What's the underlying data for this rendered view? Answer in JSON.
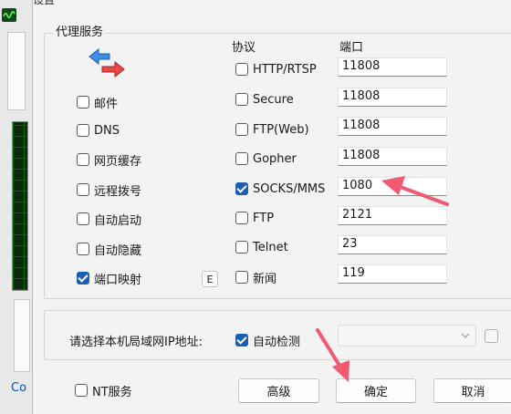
{
  "background": {
    "link_text": "Co"
  },
  "dialog": {
    "title": "设置"
  },
  "proxy_group": {
    "title": "代理服务",
    "headers": {
      "protocol": "协议",
      "port": "端口"
    },
    "services": [
      {
        "label": "邮件",
        "checked": false
      },
      {
        "label": "DNS",
        "checked": false
      },
      {
        "label": "网页缓存",
        "checked": false
      },
      {
        "label": "远程拨号",
        "checked": false
      },
      {
        "label": "自动启动",
        "checked": false
      },
      {
        "label": "自动隐藏",
        "checked": false
      },
      {
        "label": "端口映射",
        "checked": true
      }
    ],
    "port_map_button": "E",
    "protocols": [
      {
        "label": "HTTP/RTSP",
        "checked": false,
        "port": "11808"
      },
      {
        "label": "Secure",
        "checked": false,
        "port": "11808"
      },
      {
        "label": "FTP(Web)",
        "checked": false,
        "port": "11808"
      },
      {
        "label": "Gopher",
        "checked": false,
        "port": "11808"
      },
      {
        "label": "SOCKS/MMS",
        "checked": true,
        "port": "1080"
      },
      {
        "label": "FTP",
        "checked": false,
        "port": "2121"
      },
      {
        "label": "Telnet",
        "checked": false,
        "port": "23"
      },
      {
        "label": "新闻",
        "checked": false,
        "port": "119"
      }
    ]
  },
  "lan_group": {
    "label": "请选择本机局域网IP地址:",
    "auto_detect": {
      "label": "自动检测",
      "checked": true
    },
    "ip_value": ""
  },
  "footer": {
    "nt_service": {
      "label": "NT服务",
      "checked": false
    },
    "advanced_label": "高级",
    "ok_label": "确定",
    "cancel_label": "取消"
  },
  "colors": {
    "checkbox_checked": "#1a5fb4",
    "annotation_arrow": "#f05a70"
  }
}
